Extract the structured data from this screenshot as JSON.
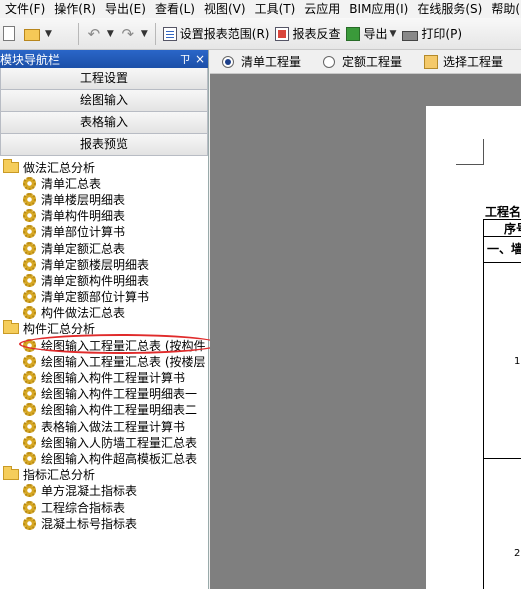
{
  "menu": [
    "文件(F)",
    "操作(R)",
    "导出(E)",
    "查看(L)",
    "视图(V)",
    "工具(T)",
    "云应用",
    "BIM应用(I)",
    "在线服务(S)",
    "帮助(H"
  ],
  "toolbar": {
    "set_range": "设置报表范围(R)",
    "report_check": "报表反查",
    "export": "导出",
    "print": "打印(P)"
  },
  "panel": {
    "title": "模块导航栏",
    "pin": "ㄗ",
    "close": "×",
    "nav_buttons": [
      "工程设置",
      "绘图输入",
      "表格输入",
      "报表预览"
    ],
    "tree": [
      {
        "type": "folder",
        "label": "做法汇总分析"
      },
      {
        "type": "item",
        "label": "清单汇总表"
      },
      {
        "type": "item",
        "label": "清单楼层明细表"
      },
      {
        "type": "item",
        "label": "清单构件明细表"
      },
      {
        "type": "item",
        "label": "清单部位计算书"
      },
      {
        "type": "item",
        "label": "清单定额汇总表"
      },
      {
        "type": "item",
        "label": "清单定额楼层明细表"
      },
      {
        "type": "item",
        "label": "清单定额构件明细表"
      },
      {
        "type": "item",
        "label": "清单定额部位计算书"
      },
      {
        "type": "item",
        "label": "构件做法汇总表"
      },
      {
        "type": "folder",
        "label": "构件汇总分析"
      },
      {
        "type": "item",
        "label": "绘图输入工程量汇总表 (按构件"
      },
      {
        "type": "item",
        "label": "绘图输入工程量汇总表 (按楼层"
      },
      {
        "type": "item",
        "label": "绘图输入构件工程量计算书"
      },
      {
        "type": "item",
        "label": "绘图输入构件工程量明细表一"
      },
      {
        "type": "item",
        "label": "绘图输入构件工程量明细表二"
      },
      {
        "type": "item",
        "label": "表格输入做法工程量计算书"
      },
      {
        "type": "item",
        "label": "绘图输入人防墙工程量汇总表"
      },
      {
        "type": "item",
        "label": "绘图输入构件超高模板汇总表"
      },
      {
        "type": "folder",
        "label": "指标汇总分析"
      },
      {
        "type": "item",
        "label": "单方混凝土指标表"
      },
      {
        "type": "item",
        "label": "工程综合指标表"
      },
      {
        "type": "item",
        "label": "混凝土标号指标表"
      }
    ]
  },
  "report": {
    "radio_qingdan": "清单工程量",
    "radio_dinge": "定额工程量",
    "select_btn": "选择工程量",
    "doc_title": "工程名",
    "col_header": "序号",
    "row_first": "一、墙",
    "row_num_1": "1",
    "row_num_2": "2"
  }
}
